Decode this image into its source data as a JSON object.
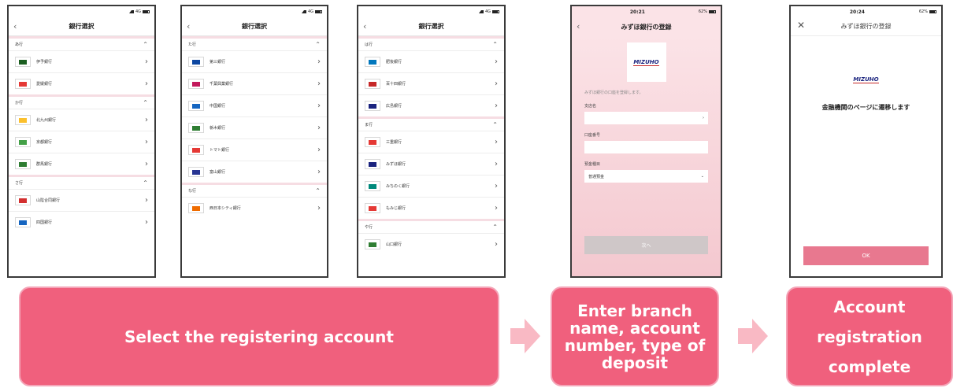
{
  "status": {
    "signal": "4G",
    "time4": "20:21",
    "time5": "20:24",
    "battery": "62%"
  },
  "screens": {
    "list1": {
      "title": "銀行選択",
      "sections": [
        {
          "label": "あ行",
          "banks": [
            {
              "name": "伊予銀行",
              "color": "#1b5e20"
            },
            {
              "name": "愛媛銀行",
              "color": "#e53935"
            }
          ]
        },
        {
          "label": "か行",
          "banks": [
            {
              "name": "北九州銀行",
              "color": "#fbc02d"
            },
            {
              "name": "京都銀行",
              "color": "#43a047"
            },
            {
              "name": "群馬銀行",
              "color": "#2e7d32"
            }
          ]
        },
        {
          "label": "さ行",
          "banks": [
            {
              "name": "山陰合同銀行",
              "color": "#d32f2f"
            },
            {
              "name": "四国銀行",
              "color": "#1565c0"
            }
          ]
        }
      ]
    },
    "list2": {
      "title": "銀行選択",
      "sections": [
        {
          "label": "た行",
          "banks": [
            {
              "name": "第三銀行",
              "color": "#0d47a1"
            },
            {
              "name": "千葉興業銀行",
              "color": "#c2185b"
            },
            {
              "name": "中国銀行",
              "color": "#1565c0"
            },
            {
              "name": "栃木銀行",
              "color": "#2e7d32"
            },
            {
              "name": "トマト銀行",
              "color": "#e53935"
            },
            {
              "name": "富山銀行",
              "color": "#283593"
            }
          ]
        },
        {
          "label": "な行",
          "banks": [
            {
              "name": "西日本シティ銀行",
              "color": "#ef6c00"
            }
          ]
        }
      ]
    },
    "list3": {
      "title": "銀行選択",
      "sections": [
        {
          "label": "は行",
          "banks": [
            {
              "name": "肥後銀行",
              "color": "#0277bd"
            },
            {
              "name": "百十四銀行",
              "color": "#c62828"
            },
            {
              "name": "広島銀行",
              "color": "#1a237e"
            }
          ]
        },
        {
          "label": "ま行",
          "banks": [
            {
              "name": "三重銀行",
              "color": "#e53935"
            },
            {
              "name": "みずほ銀行",
              "color": "#1a237e"
            },
            {
              "name": "みちのく銀行",
              "color": "#00897b"
            },
            {
              "name": "もみじ銀行",
              "color": "#e53935"
            }
          ]
        },
        {
          "label": "や行",
          "banks": [
            {
              "name": "山口銀行",
              "color": "#2e7d32"
            }
          ]
        }
      ]
    },
    "register": {
      "title": "みずほ銀行の登録",
      "logo": "MIZUHO",
      "description": "みずほ銀行の口座を登録します。",
      "branch_label": "支店名",
      "account_label": "口座番号",
      "deposit_label": "預金種目",
      "deposit_value": "普通預金",
      "next": "次へ"
    },
    "complete": {
      "title": "みずほ銀行の登録",
      "logo": "MIZUHO",
      "message": "金融機関のページに遷移します",
      "ok": "OK"
    }
  },
  "captions": {
    "step1": "Select the registering account",
    "step2": "Enter branch name, account number, type of deposit",
    "step3": "Account registration complete"
  },
  "colors": {
    "accent": "#f0607d",
    "arrow": "#f9b9c4",
    "ok_button": "#e8788f"
  }
}
